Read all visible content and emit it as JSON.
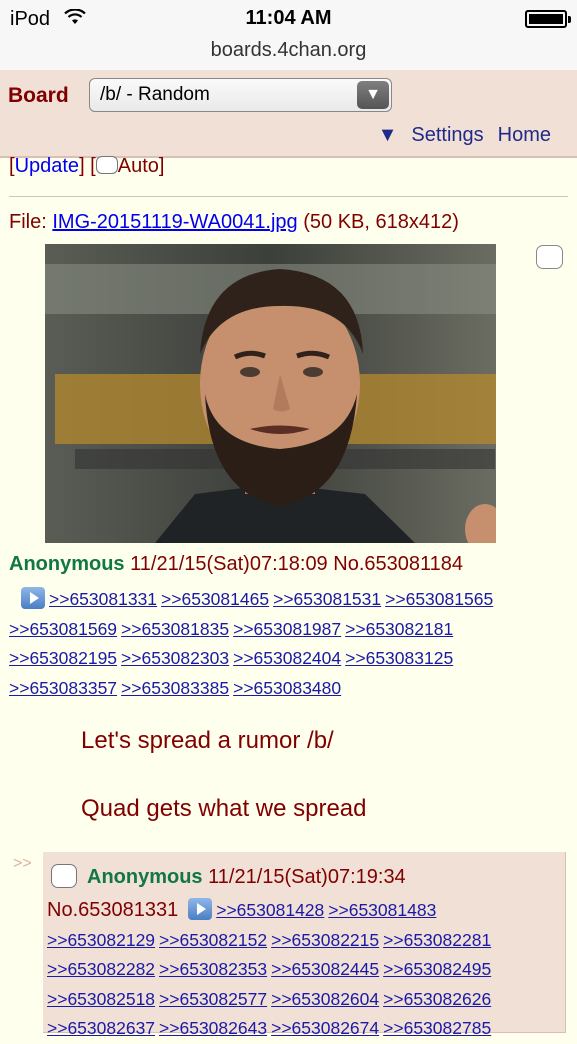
{
  "status_bar": {
    "device": "iPod",
    "time": "11:04 AM"
  },
  "browser": {
    "url": "boards.4chan.org"
  },
  "header": {
    "board_label": "Board",
    "board_select_value": "/b/ - Random",
    "settings_label": "Settings",
    "home_label": "Home"
  },
  "thread_controls": {
    "update_label": "Update",
    "auto_label": "Auto"
  },
  "op": {
    "file_prefix": "File:",
    "file_name": "IMG-20151119-WA0041.jpg",
    "file_info": "(50 KB, 618x412)",
    "name": "Anonymous",
    "datetime": "11/21/15(Sat)07:18:09",
    "post_no": "No.653081184",
    "replies": [
      ">>653081331",
      ">>653081465",
      ">>653081531",
      ">>653081565",
      ">>653081569",
      ">>653081835",
      ">>653081987",
      ">>653082181",
      ">>653082195",
      ">>653082303",
      ">>653082404",
      ">>653083125",
      ">>653083357",
      ">>653083385",
      ">>653083480"
    ],
    "comment_lines": [
      "Let's spread a rumor /b/",
      "Quad gets what we spread"
    ]
  },
  "reply1": {
    "arrows": ">>",
    "name": "Anonymous",
    "datetime": "11/21/15(Sat)07:19:34",
    "post_no": "No.653081331",
    "replies": [
      ">>653081428",
      ">>653081483",
      ">>653082129",
      ">>653082152",
      ">>653082215",
      ">>653082281",
      ">>653082282",
      ">>653082353",
      ">>653082445",
      ">>653082495",
      ">>653082518",
      ">>653082577",
      ">>653082604",
      ">>653082626",
      ">>653082637",
      ">>653082643",
      ">>653082674",
      ">>653082785"
    ]
  }
}
